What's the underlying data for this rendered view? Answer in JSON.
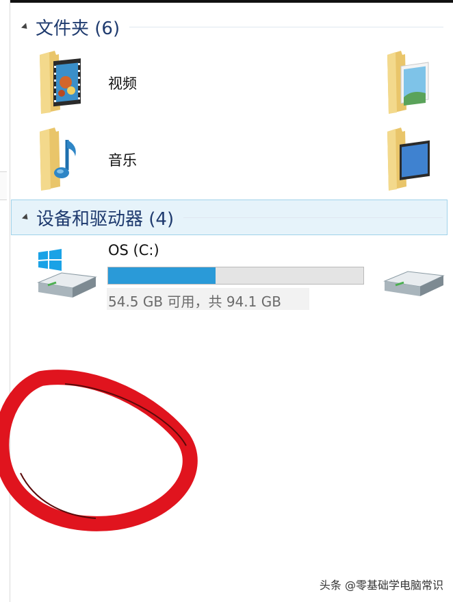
{
  "groups": {
    "folders": {
      "title": "文件夹 (6)",
      "items": [
        {
          "label": "视频",
          "icon": "videos-folder-icon"
        },
        {
          "label": "音乐",
          "icon": "music-folder-icon"
        },
        {
          "label": "",
          "icon": "pictures-folder-icon"
        },
        {
          "label": "",
          "icon": "desktop-folder-icon"
        }
      ]
    },
    "devices": {
      "title": "设备和驱动器 (4)",
      "drives": [
        {
          "name": "OS (C:)",
          "free_text": "54.5 GB 可用，共 94.1 GB",
          "used_fraction": 0.42,
          "icon": "system-drive-icon"
        }
      ]
    }
  },
  "watermark": "头条 @零基础学电脑常识",
  "colors": {
    "header_text": "#1e3a6e",
    "usage_bar": "#2a9ad8",
    "annotation": "#e0141e",
    "selected_header_bg": "#e6f3fa"
  }
}
